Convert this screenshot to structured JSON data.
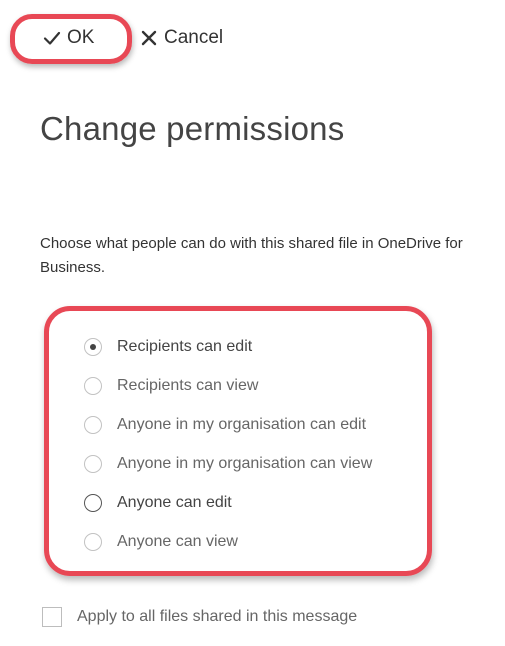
{
  "toolbar": {
    "ok_label": "OK",
    "ok_icon": "checkmark-icon",
    "cancel_label": "Cancel",
    "cancel_icon": "close-icon"
  },
  "title": "Change permissions",
  "description": "Choose what people can do with this shared file in OneDrive for Business.",
  "options": [
    {
      "label": "Recipients can edit",
      "selected": true
    },
    {
      "label": "Recipients can view",
      "selected": false
    },
    {
      "label": "Anyone in my organisation can edit",
      "selected": false
    },
    {
      "label": "Anyone in my organisation can view",
      "selected": false
    },
    {
      "label": "Anyone can edit",
      "selected": false
    },
    {
      "label": "Anyone can view",
      "selected": false
    }
  ],
  "apply_all": {
    "label": "Apply to all files shared in this message",
    "checked": false
  },
  "colors": {
    "highlight": "#e84855",
    "text": "#333333",
    "muted_text": "#666666"
  }
}
